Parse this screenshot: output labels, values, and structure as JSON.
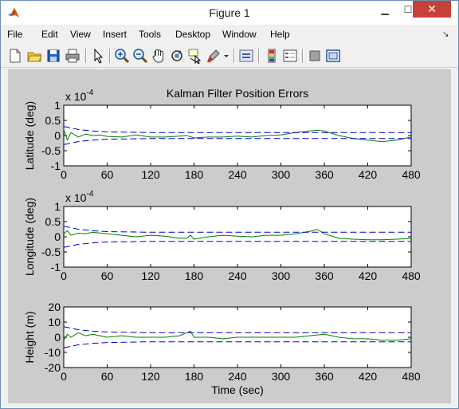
{
  "window": {
    "title": "Figure 1"
  },
  "menu": [
    "File",
    "Edit",
    "View",
    "Insert",
    "Tools",
    "Desktop",
    "Window",
    "Help"
  ],
  "toolbar": [
    "new-figure",
    "open-file",
    "save",
    "print",
    "edit-plot",
    "zoom-in",
    "zoom-out",
    "pan",
    "rotate-3d",
    "data-cursor",
    "brush",
    "brush-menu",
    "link-plot",
    "insert-colorbar",
    "insert-legend",
    "hide-plot-tools",
    "show-plot-tools"
  ],
  "colors": {
    "error_line": "#008000",
    "bound_line": "#0000cc",
    "axes_bg": "#ffffff",
    "figure_bg": "#cccccc",
    "close_button": "#c7413b"
  },
  "chart_data": [
    {
      "type": "line",
      "title": "Kalman Filter Position Errors",
      "ylabel": "Latitude (deg)",
      "exponent_label": "x 10",
      "exponent": "-4",
      "xlim": [
        0,
        480
      ],
      "ylim": [
        -1,
        1
      ],
      "xticks": [
        0,
        60,
        120,
        180,
        240,
        300,
        360,
        420,
        480
      ],
      "xtick_labels": [
        "0",
        "60",
        "120",
        "180",
        "240",
        "300",
        "360",
        "420",
        "480"
      ],
      "yticks": [
        -1,
        -0.5,
        0,
        0.5,
        1
      ],
      "ytick_labels": [
        "-1",
        "-0.5",
        "0",
        "0.5",
        "1"
      ],
      "series": [
        {
          "role": "error",
          "x": [
            0,
            5,
            10,
            20,
            30,
            40,
            50,
            60,
            80,
            100,
            120,
            140,
            160,
            170,
            180,
            200,
            220,
            240,
            260,
            280,
            300,
            320,
            340,
            350,
            360,
            380,
            400,
            420,
            440,
            460,
            480
          ],
          "y": [
            0.2,
            -0.15,
            0.1,
            -0.05,
            0.05,
            0.0,
            0.02,
            -0.03,
            -0.05,
            0.02,
            -0.05,
            -0.05,
            -0.02,
            0.0,
            -0.08,
            -0.05,
            -0.05,
            -0.02,
            -0.05,
            0.0,
            0.02,
            0.1,
            0.15,
            0.18,
            0.15,
            0.0,
            -0.1,
            -0.15,
            -0.2,
            -0.15,
            -0.05
          ]
        },
        {
          "role": "upper-bound",
          "x": [
            0,
            10,
            20,
            40,
            60,
            120,
            240,
            480
          ],
          "y": [
            0.3,
            0.25,
            0.2,
            0.15,
            0.12,
            0.1,
            0.1,
            0.1
          ]
        },
        {
          "role": "lower-bound",
          "x": [
            0,
            10,
            20,
            40,
            60,
            120,
            240,
            480
          ],
          "y": [
            -0.3,
            -0.25,
            -0.2,
            -0.15,
            -0.12,
            -0.1,
            -0.1,
            -0.1
          ]
        }
      ]
    },
    {
      "type": "line",
      "ylabel": "Longitude (deg)",
      "exponent_label": "x 10",
      "exponent": "-4",
      "xlim": [
        0,
        480
      ],
      "ylim": [
        -1,
        1
      ],
      "xticks": [
        0,
        60,
        120,
        180,
        240,
        300,
        360,
        420,
        480
      ],
      "xtick_labels": [
        "0",
        "60",
        "120",
        "180",
        "240",
        "300",
        "360",
        "420",
        "480"
      ],
      "yticks": [
        -1,
        -0.5,
        0,
        0.5,
        1
      ],
      "ytick_labels": [
        "-1",
        "-0.5",
        "0",
        "0.5",
        "1"
      ],
      "series": [
        {
          "role": "error",
          "x": [
            0,
            5,
            10,
            20,
            30,
            40,
            60,
            80,
            100,
            120,
            140,
            160,
            170,
            175,
            180,
            200,
            220,
            240,
            260,
            280,
            300,
            320,
            340,
            350,
            360,
            380,
            400,
            420,
            440,
            460,
            480
          ],
          "y": [
            0.1,
            0.2,
            0.05,
            0.12,
            0.1,
            0.15,
            0.1,
            0.05,
            0.0,
            0.05,
            0.02,
            -0.05,
            -0.05,
            0.05,
            -0.08,
            0.0,
            0.05,
            0.02,
            0.0,
            0.05,
            0.05,
            0.1,
            0.18,
            0.25,
            0.1,
            -0.05,
            -0.08,
            -0.1,
            -0.1,
            -0.08,
            -0.05
          ]
        },
        {
          "role": "upper-bound",
          "x": [
            0,
            10,
            20,
            40,
            60,
            120,
            240,
            480
          ],
          "y": [
            0.35,
            0.3,
            0.25,
            0.2,
            0.17,
            0.15,
            0.15,
            0.15
          ]
        },
        {
          "role": "lower-bound",
          "x": [
            0,
            10,
            20,
            40,
            60,
            120,
            240,
            480
          ],
          "y": [
            -0.35,
            -0.3,
            -0.25,
            -0.2,
            -0.17,
            -0.15,
            -0.15,
            -0.15
          ]
        }
      ]
    },
    {
      "type": "line",
      "ylabel": "Height (m)",
      "xlabel": "Time (sec)",
      "xlim": [
        0,
        480
      ],
      "ylim": [
        -20,
        20
      ],
      "xticks": [
        0,
        60,
        120,
        180,
        240,
        300,
        360,
        420,
        480
      ],
      "xtick_labels": [
        "0",
        "60",
        "120",
        "180",
        "240",
        "300",
        "360",
        "420",
        "480"
      ],
      "yticks": [
        -20,
        -10,
        0,
        10,
        20
      ],
      "ytick_labels": [
        "-20",
        "-10",
        "0",
        "10",
        "20"
      ],
      "series": [
        {
          "role": "error",
          "x": [
            0,
            5,
            10,
            20,
            30,
            40,
            60,
            80,
            100,
            120,
            140,
            160,
            170,
            175,
            180,
            200,
            220,
            240,
            260,
            280,
            300,
            320,
            340,
            360,
            380,
            400,
            420,
            440,
            460,
            480
          ],
          "y": [
            -2,
            2,
            0,
            3,
            1,
            2,
            0,
            1,
            0,
            0,
            0,
            1,
            3,
            4,
            0,
            0,
            -1,
            0,
            0,
            0,
            0,
            0,
            1,
            2,
            0,
            -1,
            -1,
            -2,
            -2,
            -1
          ]
        },
        {
          "role": "upper-bound",
          "x": [
            0,
            10,
            20,
            40,
            60,
            120,
            240,
            480
          ],
          "y": [
            7,
            6,
            5,
            4,
            3.5,
            3,
            3,
            3
          ]
        },
        {
          "role": "lower-bound",
          "x": [
            0,
            10,
            20,
            40,
            60,
            120,
            240,
            480
          ],
          "y": [
            -7,
            -6,
            -5,
            -4,
            -3.5,
            -3,
            -3,
            -3
          ]
        }
      ]
    }
  ]
}
